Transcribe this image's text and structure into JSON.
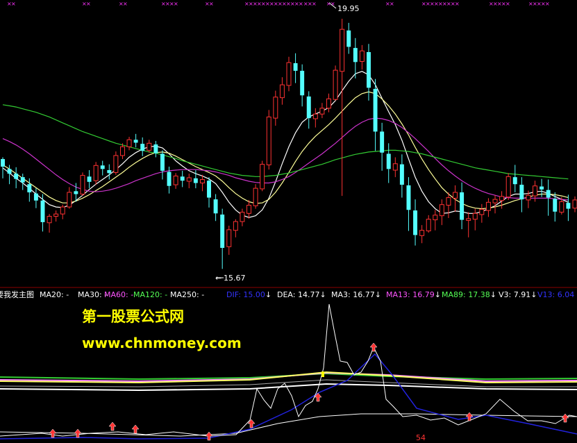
{
  "chart_data": {
    "type": "candlestick",
    "high_label": "19.95",
    "low_label": "15.67",
    "upper_legend": {
      "title": "要我发主图",
      "items": [
        {
          "label": "MA20: -",
          "color": "#ffffff"
        },
        {
          "label": "MA30: -",
          "color": "#ffffff"
        },
        {
          "label": "MA60: -",
          "color": "#ff55ff"
        },
        {
          "label": "MA120: -",
          "color": "#55ff55"
        },
        {
          "label": "MA250: -",
          "color": "#ffffff"
        }
      ]
    },
    "lower_legend": [
      {
        "label": "DIF: 15.00",
        "arrow": "↓",
        "color": "#3333ff"
      },
      {
        "label": "DEA: 14.77",
        "arrow": "↓",
        "color": "#ffffff"
      },
      {
        "label": "MA3: 16.77",
        "arrow": "↓",
        "color": "#ffffff"
      },
      {
        "label": "MA13: 16.79",
        "arrow": "↓",
        "color": "#ff55ff"
      },
      {
        "label": "MA89: 17.38",
        "arrow": "↓",
        "color": "#55ff55"
      },
      {
        "label": "V3: 7.91",
        "arrow": "↓",
        "color": "#ffffff"
      },
      {
        "label": "V13: 6.04",
        "arrow": "",
        "color": "#3333ff"
      }
    ],
    "indicator_value_label": "54",
    "price_range": [
      15.4,
      20.2
    ],
    "candles": [
      {
        "o": 17.55,
        "h": 17.58,
        "c": 17.42,
        "l": 17.22
      },
      {
        "o": 17.38,
        "h": 17.45,
        "c": 17.3,
        "l": 17.12
      },
      {
        "o": 17.3,
        "h": 17.41,
        "c": 17.21,
        "l": 17.05
      },
      {
        "o": 17.24,
        "h": 17.3,
        "c": 17.15,
        "l": 17.02
      },
      {
        "o": 17.12,
        "h": 17.22,
        "c": 16.98,
        "l": 16.82
      },
      {
        "o": 16.96,
        "h": 17.05,
        "c": 16.84,
        "l": 16.71
      },
      {
        "o": 16.84,
        "h": 16.95,
        "c": 16.47,
        "l": 16.31
      },
      {
        "o": 16.46,
        "h": 16.61,
        "c": 16.57,
        "l": 16.29
      },
      {
        "o": 16.57,
        "h": 16.67,
        "c": 16.61,
        "l": 16.48
      },
      {
        "o": 16.61,
        "h": 16.77,
        "c": 16.73,
        "l": 16.52
      },
      {
        "o": 16.73,
        "h": 17.07,
        "c": 16.98,
        "l": 16.7
      },
      {
        "o": 17.0,
        "h": 17.14,
        "c": 16.95,
        "l": 16.82
      },
      {
        "o": 16.95,
        "h": 17.32,
        "c": 17.27,
        "l": 16.92
      },
      {
        "o": 17.25,
        "h": 17.36,
        "c": 17.16,
        "l": 17.05
      },
      {
        "o": 17.18,
        "h": 17.5,
        "c": 17.44,
        "l": 17.11
      },
      {
        "o": 17.44,
        "h": 17.52,
        "c": 17.38,
        "l": 17.27
      },
      {
        "o": 17.36,
        "h": 17.46,
        "c": 17.31,
        "l": 17.2
      },
      {
        "o": 17.32,
        "h": 17.68,
        "c": 17.61,
        "l": 17.28
      },
      {
        "o": 17.61,
        "h": 17.82,
        "c": 17.76,
        "l": 17.55
      },
      {
        "o": 17.76,
        "h": 17.93,
        "c": 17.88,
        "l": 17.7
      },
      {
        "o": 17.88,
        "h": 17.98,
        "c": 17.83,
        "l": 17.75
      },
      {
        "o": 17.81,
        "h": 17.92,
        "c": 17.69,
        "l": 17.6
      },
      {
        "o": 17.7,
        "h": 17.88,
        "c": 17.82,
        "l": 17.66
      },
      {
        "o": 17.8,
        "h": 17.86,
        "c": 17.65,
        "l": 17.58
      },
      {
        "o": 17.64,
        "h": 17.7,
        "c": 17.35,
        "l": 17.2
      },
      {
        "o": 17.33,
        "h": 17.42,
        "c": 17.09,
        "l": 16.96
      },
      {
        "o": 17.11,
        "h": 17.31,
        "c": 17.26,
        "l": 17.04
      },
      {
        "o": 17.25,
        "h": 17.35,
        "c": 17.18,
        "l": 17.07
      },
      {
        "o": 17.17,
        "h": 17.3,
        "c": 17.23,
        "l": 17.05
      },
      {
        "o": 17.22,
        "h": 17.36,
        "c": 17.14,
        "l": 17.05
      },
      {
        "o": 17.14,
        "h": 17.28,
        "c": 17.2,
        "l": 17.0
      },
      {
        "o": 17.18,
        "h": 17.24,
        "c": 16.89,
        "l": 16.72
      },
      {
        "o": 16.86,
        "h": 16.95,
        "c": 16.62,
        "l": 16.49
      },
      {
        "o": 16.6,
        "h": 16.7,
        "c": 16.03,
        "l": 15.67
      },
      {
        "o": 16.05,
        "h": 16.41,
        "c": 16.34,
        "l": 15.91
      },
      {
        "o": 16.33,
        "h": 16.52,
        "c": 16.48,
        "l": 16.21
      },
      {
        "o": 16.48,
        "h": 16.7,
        "c": 16.64,
        "l": 16.4
      },
      {
        "o": 16.62,
        "h": 16.85,
        "c": 16.76,
        "l": 16.53
      },
      {
        "o": 16.75,
        "h": 17.12,
        "c": 17.05,
        "l": 16.7
      },
      {
        "o": 17.04,
        "h": 17.52,
        "c": 17.46,
        "l": 17.0
      },
      {
        "o": 17.45,
        "h": 18.39,
        "c": 18.27,
        "l": 17.37
      },
      {
        "o": 18.25,
        "h": 18.72,
        "c": 18.61,
        "l": 18.12
      },
      {
        "o": 18.6,
        "h": 18.95,
        "c": 18.82,
        "l": 18.48
      },
      {
        "o": 18.81,
        "h": 19.3,
        "c": 19.2,
        "l": 18.71
      },
      {
        "o": 19.19,
        "h": 19.36,
        "c": 19.06,
        "l": 18.85
      },
      {
        "o": 19.06,
        "h": 19.17,
        "c": 18.64,
        "l": 18.45
      },
      {
        "o": 18.62,
        "h": 18.71,
        "c": 18.25,
        "l": 18.07
      },
      {
        "o": 18.24,
        "h": 18.42,
        "c": 18.32,
        "l": 18.09
      },
      {
        "o": 18.32,
        "h": 18.51,
        "c": 18.42,
        "l": 18.25
      },
      {
        "o": 18.42,
        "h": 18.67,
        "c": 18.58,
        "l": 18.35
      },
      {
        "o": 18.57,
        "h": 19.15,
        "c": 19.07,
        "l": 18.55
      },
      {
        "o": 19.05,
        "h": 19.95,
        "c": 19.77,
        "l": 16.92
      },
      {
        "o": 19.75,
        "h": 19.88,
        "c": 19.47,
        "l": 19.35
      },
      {
        "o": 19.45,
        "h": 19.62,
        "c": 19.21,
        "l": 18.93
      },
      {
        "o": 19.22,
        "h": 19.5,
        "c": 19.4,
        "l": 19.08
      },
      {
        "o": 19.38,
        "h": 19.52,
        "c": 18.77,
        "l": 18.55
      },
      {
        "o": 18.75,
        "h": 18.92,
        "c": 18.02,
        "l": 17.69
      },
      {
        "o": 18.02,
        "h": 18.17,
        "c": 17.66,
        "l": 17.35
      },
      {
        "o": 17.64,
        "h": 17.82,
        "c": 17.38,
        "l": 17.14
      },
      {
        "o": 17.36,
        "h": 17.58,
        "c": 17.47,
        "l": 17.24
      },
      {
        "o": 17.46,
        "h": 17.63,
        "c": 17.11,
        "l": 16.89
      },
      {
        "o": 17.1,
        "h": 17.24,
        "c": 16.68,
        "l": 16.32
      },
      {
        "o": 16.67,
        "h": 16.86,
        "c": 16.25,
        "l": 16.07
      },
      {
        "o": 16.24,
        "h": 16.42,
        "c": 16.33,
        "l": 16.11
      },
      {
        "o": 16.32,
        "h": 16.59,
        "c": 16.52,
        "l": 16.29
      },
      {
        "o": 16.51,
        "h": 16.68,
        "c": 16.59,
        "l": 16.33
      },
      {
        "o": 16.58,
        "h": 16.86,
        "c": 16.77,
        "l": 16.42
      },
      {
        "o": 16.76,
        "h": 16.98,
        "c": 16.89,
        "l": 16.54
      },
      {
        "o": 16.88,
        "h": 17.1,
        "c": 16.98,
        "l": 16.65
      },
      {
        "o": 16.98,
        "h": 17.15,
        "c": 16.51,
        "l": 16.35
      },
      {
        "o": 16.5,
        "h": 16.64,
        "c": 16.53,
        "l": 16.21
      },
      {
        "o": 16.52,
        "h": 16.7,
        "c": 16.62,
        "l": 16.33
      },
      {
        "o": 16.6,
        "h": 16.78,
        "c": 16.69,
        "l": 16.46
      },
      {
        "o": 16.67,
        "h": 16.88,
        "c": 16.81,
        "l": 16.56
      },
      {
        "o": 16.8,
        "h": 16.93,
        "c": 16.86,
        "l": 16.62
      },
      {
        "o": 16.84,
        "h": 17.0,
        "c": 16.91,
        "l": 16.7
      },
      {
        "o": 16.9,
        "h": 17.31,
        "c": 17.25,
        "l": 16.85
      },
      {
        "o": 17.24,
        "h": 17.45,
        "c": 17.12,
        "l": 16.98
      },
      {
        "o": 17.11,
        "h": 17.24,
        "c": 16.86,
        "l": 16.64
      },
      {
        "o": 16.85,
        "h": 17.01,
        "c": 16.93,
        "l": 16.71
      },
      {
        "o": 16.92,
        "h": 17.18,
        "c": 17.09,
        "l": 16.82
      },
      {
        "o": 17.08,
        "h": 17.21,
        "c": 17.03,
        "l": 16.9
      },
      {
        "o": 17.02,
        "h": 17.2,
        "c": 16.89,
        "l": 16.58
      },
      {
        "o": 16.87,
        "h": 16.98,
        "c": 16.65,
        "l": 16.48
      },
      {
        "o": 16.64,
        "h": 16.9,
        "c": 16.82,
        "l": 16.6
      },
      {
        "o": 16.8,
        "h": 16.94,
        "c": 16.7,
        "l": 16.49
      },
      {
        "o": 16.71,
        "h": 16.91,
        "c": 16.85,
        "l": 16.64
      }
    ],
    "moving_averages": [
      {
        "name": "MA20",
        "color": "#ffffff",
        "values": [
          17.4,
          17.31,
          17.22,
          17.14,
          17.05,
          16.95,
          16.86,
          16.77,
          16.73,
          16.72,
          16.76,
          16.84,
          16.93,
          17.03,
          17.12,
          17.2,
          17.28,
          17.37,
          17.47,
          17.58,
          17.66,
          17.72,
          17.76,
          17.77,
          17.74,
          17.64,
          17.52,
          17.43,
          17.35,
          17.3,
          17.26,
          17.21,
          17.13,
          16.98,
          16.81,
          16.68,
          16.59,
          16.55,
          16.58,
          16.68,
          16.88,
          17.16,
          17.47,
          17.76,
          18.0,
          18.18,
          18.27,
          18.32,
          18.37,
          18.43,
          18.55,
          18.72,
          18.88,
          19.01,
          19.05,
          18.99,
          18.82,
          18.59,
          18.36,
          18.14,
          17.87,
          17.55,
          17.24,
          17.0,
          16.82,
          16.7,
          16.62,
          16.63,
          16.66,
          16.65,
          16.62,
          16.62,
          16.65,
          16.7,
          16.75,
          16.83,
          16.91,
          16.95,
          16.95,
          16.96,
          16.99,
          17.0,
          16.96,
          16.91,
          16.86,
          16.81
        ]
      },
      {
        "name": "MA30",
        "color": "#ffff99",
        "values": [
          17.45,
          17.38,
          17.3,
          17.22,
          17.14,
          17.06,
          16.98,
          16.9,
          16.84,
          16.8,
          16.8,
          16.83,
          16.88,
          16.94,
          17.01,
          17.08,
          17.16,
          17.24,
          17.32,
          17.41,
          17.49,
          17.56,
          17.62,
          17.66,
          17.67,
          17.65,
          17.6,
          17.54,
          17.48,
          17.42,
          17.37,
          17.32,
          17.26,
          17.17,
          17.06,
          16.96,
          16.88,
          16.82,
          16.79,
          16.8,
          16.86,
          16.98,
          17.14,
          17.32,
          17.51,
          17.68,
          17.82,
          17.94,
          18.04,
          18.14,
          18.25,
          18.37,
          18.49,
          18.6,
          18.67,
          18.7,
          18.67,
          18.58,
          18.46,
          18.32,
          18.15,
          17.96,
          17.75,
          17.55,
          17.37,
          17.21,
          17.06,
          16.95,
          16.86,
          16.79,
          16.74,
          16.71,
          16.7,
          16.71,
          16.73,
          16.76,
          16.8,
          16.84,
          16.87,
          16.9,
          16.93,
          16.95,
          16.95,
          16.94,
          16.92,
          16.89
        ]
      },
      {
        "name": "MA60",
        "color": "#cc33cc",
        "values": [
          17.9,
          17.85,
          17.79,
          17.72,
          17.64,
          17.55,
          17.46,
          17.37,
          17.28,
          17.2,
          17.13,
          17.07,
          17.03,
          17.0,
          16.99,
          17.0,
          17.02,
          17.05,
          17.09,
          17.13,
          17.18,
          17.22,
          17.26,
          17.3,
          17.33,
          17.35,
          17.36,
          17.37,
          17.37,
          17.37,
          17.36,
          17.35,
          17.33,
          17.3,
          17.27,
          17.23,
          17.2,
          17.17,
          17.15,
          17.14,
          17.14,
          17.16,
          17.2,
          17.25,
          17.32,
          17.4,
          17.48,
          17.56,
          17.64,
          17.73,
          17.82,
          17.92,
          18.02,
          18.11,
          18.18,
          18.23,
          18.25,
          18.24,
          18.21,
          18.16,
          18.09,
          18.0,
          17.9,
          17.79,
          17.68,
          17.56,
          17.45,
          17.35,
          17.26,
          17.18,
          17.11,
          17.05,
          17.0,
          16.96,
          16.93,
          16.9,
          16.89,
          16.88,
          16.88,
          16.88,
          16.88,
          16.88,
          16.88,
          16.87,
          16.86,
          16.85
        ]
      },
      {
        "name": "MA120",
        "color": "#33cc33",
        "values": [
          18.48,
          18.46,
          18.44,
          18.41,
          18.38,
          18.35,
          18.31,
          18.27,
          18.22,
          18.17,
          18.12,
          18.07,
          18.02,
          17.98,
          17.94,
          17.9,
          17.86,
          17.82,
          17.79,
          17.76,
          17.73,
          17.7,
          17.67,
          17.65,
          17.62,
          17.59,
          17.56,
          17.52,
          17.49,
          17.46,
          17.43,
          17.4,
          17.37,
          17.34,
          17.31,
          17.29,
          17.27,
          17.26,
          17.25,
          17.25,
          17.26,
          17.27,
          17.29,
          17.31,
          17.34,
          17.37,
          17.4,
          17.43,
          17.46,
          17.5,
          17.54,
          17.57,
          17.6,
          17.63,
          17.65,
          17.67,
          17.68,
          17.69,
          17.7,
          17.7,
          17.69,
          17.68,
          17.66,
          17.64,
          17.61,
          17.58,
          17.55,
          17.52,
          17.49,
          17.46,
          17.43,
          17.4,
          17.38,
          17.36,
          17.34,
          17.32,
          17.3,
          17.29,
          17.28,
          17.27,
          17.26,
          17.25,
          17.24,
          17.23,
          17.22,
          17.21
        ]
      }
    ]
  }
}
